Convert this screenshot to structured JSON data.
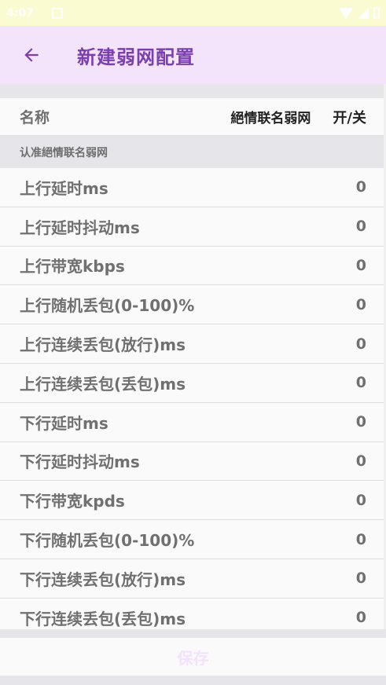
{
  "status_bar": {
    "time": "4:07"
  },
  "app_bar": {
    "title": "新建弱网配置"
  },
  "header": {
    "name_label": "名称",
    "value": "絕情联名弱网",
    "toggle_label": "开/关"
  },
  "section": {
    "title": "认准絕情联名弱网"
  },
  "rows": [
    {
      "label": "上行延时ms",
      "value": "0"
    },
    {
      "label": "上行延时抖动ms",
      "value": "0"
    },
    {
      "label": "上行带宽kbps",
      "value": "0"
    },
    {
      "label": "上行随机丢包(0-100)%",
      "value": "0"
    },
    {
      "label": "上行连续丢包(放行)ms",
      "value": "0"
    },
    {
      "label": "上行连续丢包(丢包)ms",
      "value": "0"
    },
    {
      "label": "下行延时ms",
      "value": "0"
    },
    {
      "label": "下行延时抖动ms",
      "value": "0"
    },
    {
      "label": "下行带宽kpds",
      "value": "0"
    },
    {
      "label": "下行随机丢包(0-100)%",
      "value": "0"
    },
    {
      "label": "下行连续丢包(放行)ms",
      "value": "0"
    },
    {
      "label": "下行连续丢包(丢包)ms",
      "value": "0"
    }
  ],
  "footer": {
    "save_label": "保存"
  },
  "colors": {
    "app_bar_bg": "#f3e3fb",
    "accent": "#7b3fb0",
    "status_bar_bg": "#fbfbd2",
    "divider": "#e6e6ea"
  },
  "icons": {
    "back": "arrow-left-icon",
    "notification": "notification-icon",
    "wifi": "wifi-icon",
    "signal": "signal-icon",
    "battery": "battery-icon"
  }
}
